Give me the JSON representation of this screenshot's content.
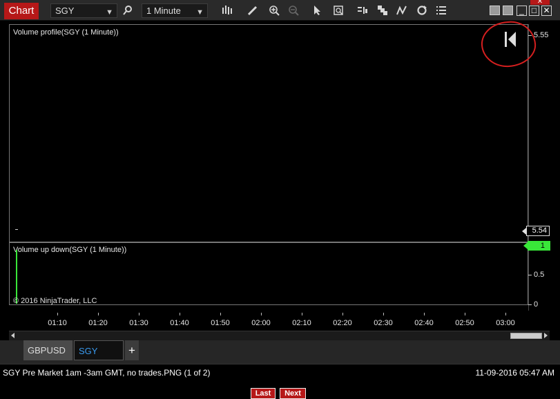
{
  "toolbar": {
    "chart_tab": "Chart",
    "instrument": "SGY",
    "interval": "1 Minute",
    "icons": [
      "search-icon",
      "bars-icon",
      "pencil-icon",
      "zoom-in-icon",
      "zoom-out-icon",
      "pointer-icon",
      "data-box-icon",
      "chart-style-icon",
      "drawing-tools-icon",
      "indicators-icon",
      "refresh-icon",
      "properties-icon"
    ]
  },
  "panels": {
    "price_label": "Volume profile(SGY (1 Minute))",
    "volume_label": "Volume up down(SGY (1 Minute))",
    "copyright": "© 2016 NinjaTrader, LLC"
  },
  "y_axis": {
    "price_top": "5.55",
    "price_current": "5.54",
    "vol_tag": "1",
    "vol_mid": "0.5",
    "vol_zero": "0"
  },
  "x_axis": {
    "labels": [
      "01:10",
      "01:20",
      "01:30",
      "01:40",
      "01:50",
      "02:00",
      "02:10",
      "02:20",
      "02:30",
      "02:40",
      "02:50",
      "03:00"
    ]
  },
  "tabs": {
    "items": [
      "GBPUSD",
      "SGY"
    ],
    "add": "+"
  },
  "status": {
    "caption": "SGY Pre Market 1am -3am GMT, no trades.PNG (1 of 2)",
    "timestamp": "11-09-2016 05:47 AM",
    "last": "Last",
    "next": "Next"
  },
  "colors": {
    "accent": "#b61818",
    "volume_up": "#39e739",
    "annotation": "#d51f1f",
    "selected_tab": "#3a9bf0"
  }
}
